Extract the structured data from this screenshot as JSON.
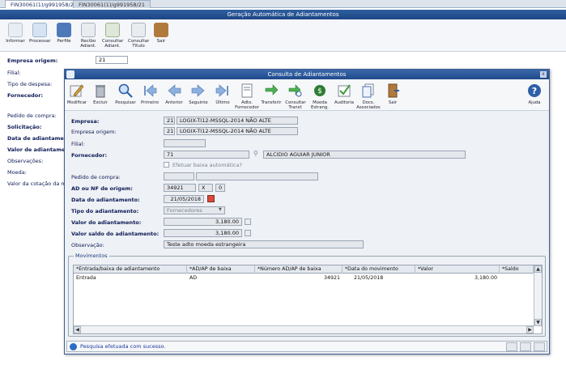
{
  "tabs": [
    "FIN30061(1)/g991958/21",
    "FIN30061(1)/g991958/21"
  ],
  "background": {
    "title": "Geração Automática de Adiantamentos",
    "toolbar": [
      "Informar",
      "Processar",
      "Perfile",
      "Recibo Adiant.",
      "Consultar Adiant.",
      "Consultar Título",
      "Sair"
    ],
    "labels": {
      "empresa_origem": "Empresa origem:",
      "filial": "Filial:",
      "tipo_despesa": "Tipo de despesa:",
      "fornecedor": "Fornecedor:",
      "pedido_compra": "Pedido de compra:",
      "solicitacao": "Solicitação:",
      "data_adiantamento": "Data de adiantamento:",
      "valor_adiantamento": "Valor de adiantamento:",
      "observacoes": "Observações:",
      "moeda": "Moeda:",
      "valor_cotacao": "Valor da cotação da mo"
    },
    "empresa_origem_value": "21"
  },
  "modal": {
    "title": "Consulta de Adiantamentos",
    "close": "x",
    "toolbar": [
      "Modificar",
      "Excluir",
      "Pesquisar",
      "Primeiro",
      "Anterior",
      "Seguinte",
      "Último",
      "Adto. Fornecedor",
      "Transferir",
      "Consultar Transf.",
      "Moeda Estrang.",
      "Auditoria",
      "Docs. Associados",
      "Sair",
      "Ajuda"
    ],
    "labels": {
      "empresa": "Empresa:",
      "empresa_origem": "Empresa origem:",
      "filial": "Filial:",
      "fornecedor": "Fornecedor:",
      "efetuar_baixa": "Efetuar baixa automática?",
      "pedido_compra": "Pedido de compra:",
      "ad_nf_origem": "AD ou NF de origem:",
      "data_adiantamento": "Data do adiantamento:",
      "tipo_adiantamento": "Tipo do adiantamento:",
      "valor_adiantamento": "Valor do adiantamento:",
      "valor_saldo": "Valor saldo do adiantamento:",
      "observacao": "Observação:"
    },
    "values": {
      "empresa_code": "21",
      "empresa_name": "LOGIX-TI12-MSSQL-2014 NÃO ALTE",
      "empresa_origem_code": "21",
      "empresa_origem_name": "LOGIX-TI12-MSSQL-2014 NÃO ALTE",
      "filial": "",
      "fornecedor_code": "71",
      "fornecedor_name": "ALCIDIO AGUIAR JUNIOR",
      "pedido_compra": "",
      "ad_nf_number": "34921",
      "ad_nf_type": "X",
      "ad_nf_seq": "0",
      "data_adiantamento": "21/05/2018",
      "tipo_adiantamento": "Fornecedores",
      "valor_adiantamento": "3,180.00",
      "valor_saldo": "3,180.00",
      "observacao": "Teste adto moeda estrangeira"
    },
    "movimentos": {
      "title": "Movimentos",
      "columns": [
        "*Entrada/baixa de adiantamento",
        "*AD/AP de baixa",
        "*Número AD/AP de baixa",
        "*Data do movimento",
        "*Valor",
        "*Saldo"
      ],
      "rows": [
        [
          "Entrada",
          "AD",
          "34921",
          "21/05/2018",
          "3,180.00",
          ""
        ]
      ]
    },
    "status": "Pesquisa efetuada com sucesso."
  }
}
